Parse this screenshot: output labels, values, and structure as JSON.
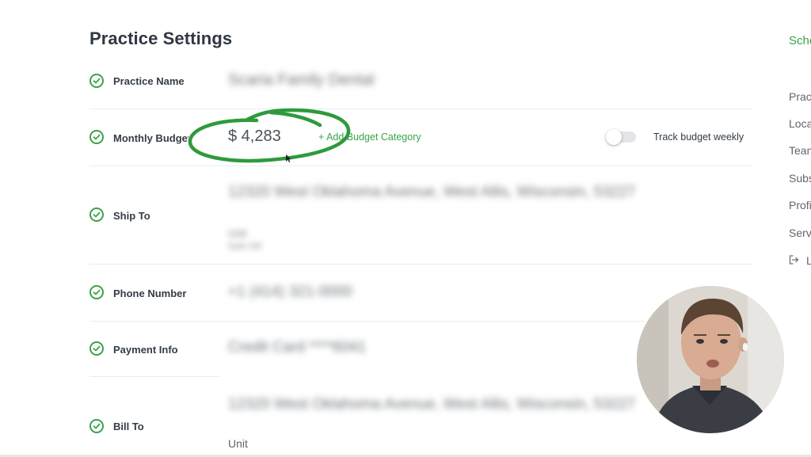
{
  "page": {
    "title": "Practice Settings"
  },
  "rows": {
    "practice_name": {
      "label": "Practice Name",
      "value": "Scaria Family Dental"
    },
    "monthly_budget": {
      "label": "Monthly Budget",
      "value": "$ 4,283",
      "add_link": "+ Add Budget Category",
      "toggle_label": "Track budget weekly",
      "toggle_on": false
    },
    "ship_to": {
      "label": "Ship To",
      "value": "12320 West Oklahoma Avenue, West Allis, Wisconsin, 53227",
      "sub1": "Unit",
      "sub2": "Suite 100"
    },
    "phone": {
      "label": "Phone Number",
      "value": "+1 (414) 321-0000"
    },
    "payment": {
      "label": "Payment Info",
      "value": "Credit Card ****6041"
    },
    "bill_to": {
      "label": "Bill To",
      "value": "12320 West Oklahoma Avenue, West Allis, Wisconsin, 53227",
      "unit_label": "Unit"
    }
  },
  "sidebar": {
    "schedule": "Sche",
    "items": [
      "Prac",
      "Loca",
      "Tean",
      "Subs",
      "Profi",
      "Serv"
    ],
    "logout": "L"
  },
  "colors": {
    "accent": "#3ba34a",
    "annotation": "#2f9a3c"
  },
  "icons": {
    "row_status": "check-circle-icon",
    "logout": "logout-icon"
  }
}
